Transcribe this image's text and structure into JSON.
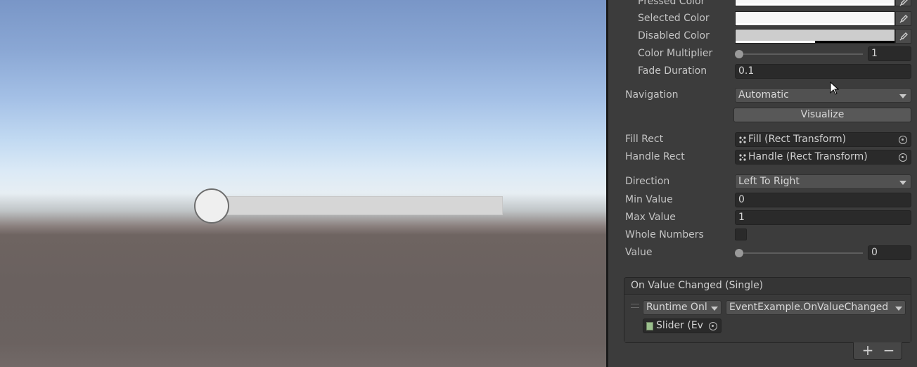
{
  "inspector": {
    "pressed_color_label": "Pressed Color",
    "selected_color_label": "Selected Color",
    "disabled_color_label": "Disabled Color",
    "color_multiplier_label": "Color Multiplier",
    "color_multiplier_value": "1",
    "fade_duration_label": "Fade Duration",
    "fade_duration_value": "0.1",
    "navigation_label": "Navigation",
    "navigation_value": "Automatic",
    "visualize_label": "Visualize",
    "fill_rect_label": "Fill Rect",
    "fill_rect_value": "Fill (Rect Transform)",
    "handle_rect_label": "Handle Rect",
    "handle_rect_value": "Handle (Rect Transform)",
    "direction_label": "Direction",
    "direction_value": "Left To Right",
    "min_value_label": "Min Value",
    "min_value_value": "0",
    "max_value_label": "Max Value",
    "max_value_value": "1",
    "whole_numbers_label": "Whole Numbers",
    "whole_numbers_checked": false,
    "value_label": "Value",
    "value_value": "0",
    "value_fraction": 0
  },
  "event": {
    "title": "On Value Changed (Single)",
    "runtime_mode": "Runtime Onl",
    "function": "EventExample.OnValueChanged",
    "target_object": "Slider (Ev",
    "add_label": "+",
    "remove_label": "−"
  },
  "scene": {
    "slider_value_fraction": 0
  },
  "icons": [
    "eyedropper-icon",
    "rect-transform-icon",
    "object-picker-icon",
    "script-icon",
    "dropdown-caret-icon",
    "mouse-cursor-icon"
  ]
}
